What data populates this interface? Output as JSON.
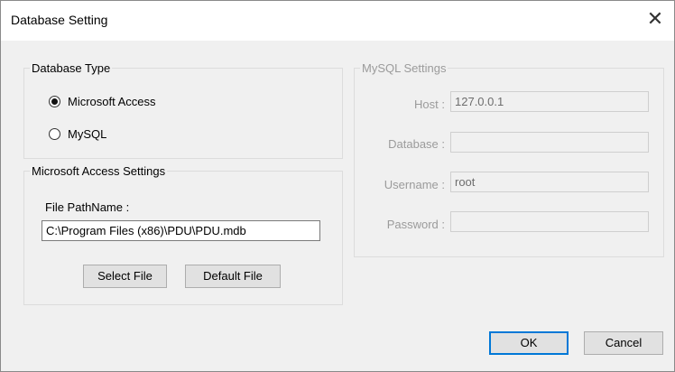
{
  "window": {
    "title": "Database Setting",
    "close_glyph": "✕"
  },
  "database_type": {
    "legend": "Database Type",
    "options": [
      {
        "label": "Microsoft Access",
        "checked": true
      },
      {
        "label": "MySQL",
        "checked": false
      }
    ]
  },
  "access_settings": {
    "legend": "Microsoft Access Settings",
    "file_label": "File PathName :",
    "file_value": "C:\\Program Files (x86)\\PDU\\PDU.mdb",
    "select_file": "Select File",
    "default_file": "Default File"
  },
  "mysql_settings": {
    "legend": "MySQL Settings",
    "host_label": "Host :",
    "host_value": "127.0.0.1",
    "database_label": "Database :",
    "database_value": "",
    "username_label": "Username :",
    "username_value": "root",
    "password_label": "Password :",
    "password_value": ""
  },
  "buttons": {
    "ok": "OK",
    "cancel": "Cancel"
  },
  "colors": {
    "accent": "#0078d7",
    "disabled_text": "#9b9b9b"
  }
}
